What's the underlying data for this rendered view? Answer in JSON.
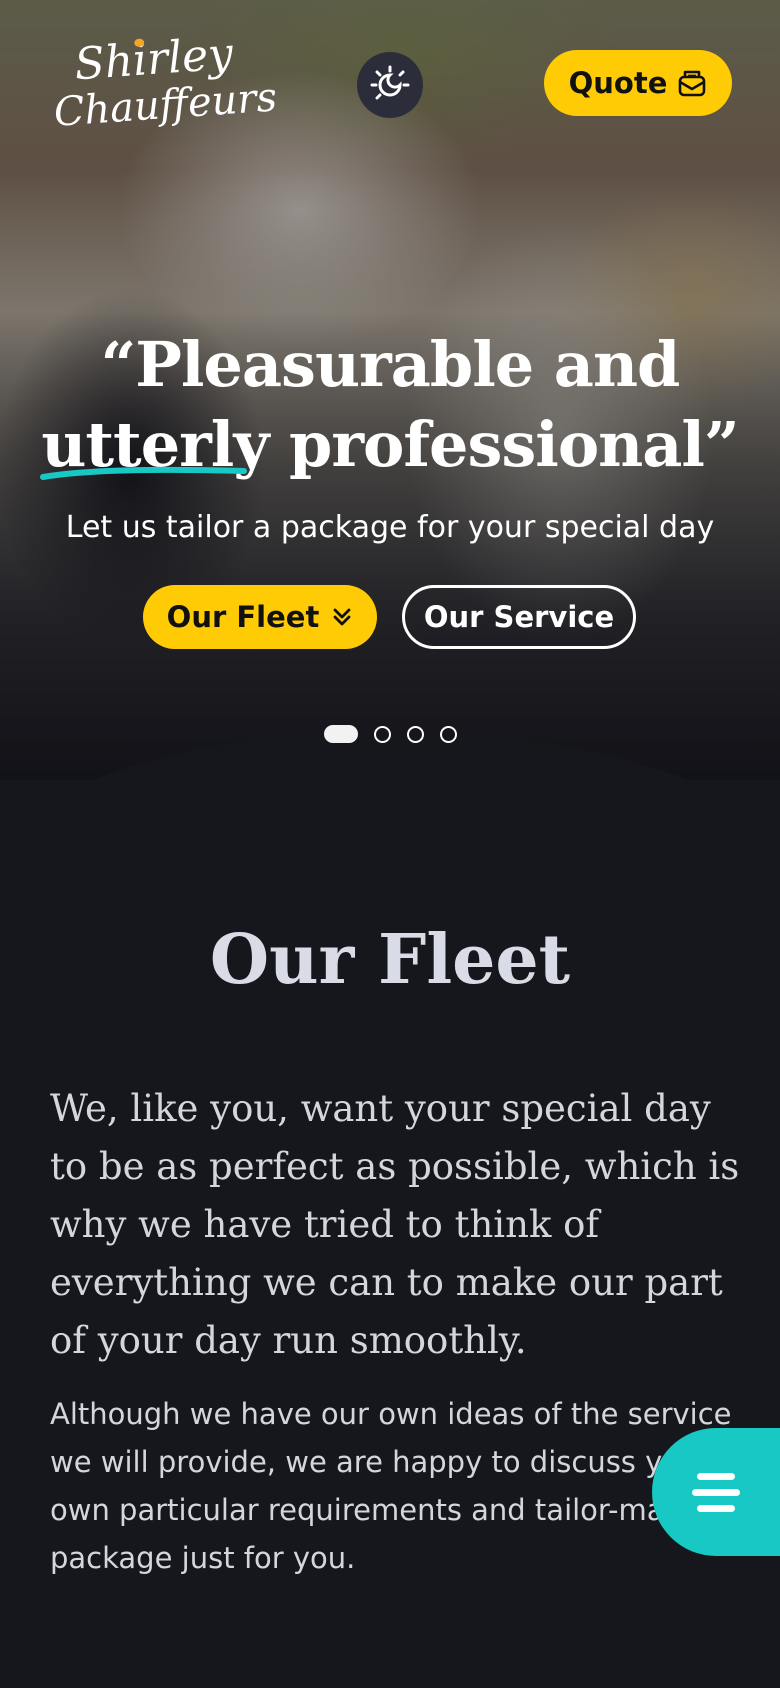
{
  "brand": {
    "line1": "Shirley",
    "line2": "Chauffeurs",
    "accent": "#f5a623"
  },
  "header": {
    "quote_label": "Quote",
    "theme_icon": "sun-moon-icon",
    "quote_icon": "envelope-icon"
  },
  "hero": {
    "headline_part1": "“Pleasurable and",
    "headline_underlined": "utterly",
    "headline_part2": " professional”",
    "subline": "Let us tailor a package for your special day",
    "btn_fleet": "Our Fleet",
    "btn_service": "Our Service",
    "slides_total": 4,
    "slide_active": 1
  },
  "fleet": {
    "title": "Our Fleet",
    "lead": "We, like you, want your special day to be as perfect as possible, which is why we have tried to think of everything we can to make our part of your day run smoothly.",
    "body": "Although we have our own ideas of the service we will provide, we are happy to discuss your own particular requirements and tailor-make a package just for you."
  },
  "colors": {
    "yellow": "#ffcb05",
    "teal": "#17c8c4",
    "background": "#16171d"
  }
}
